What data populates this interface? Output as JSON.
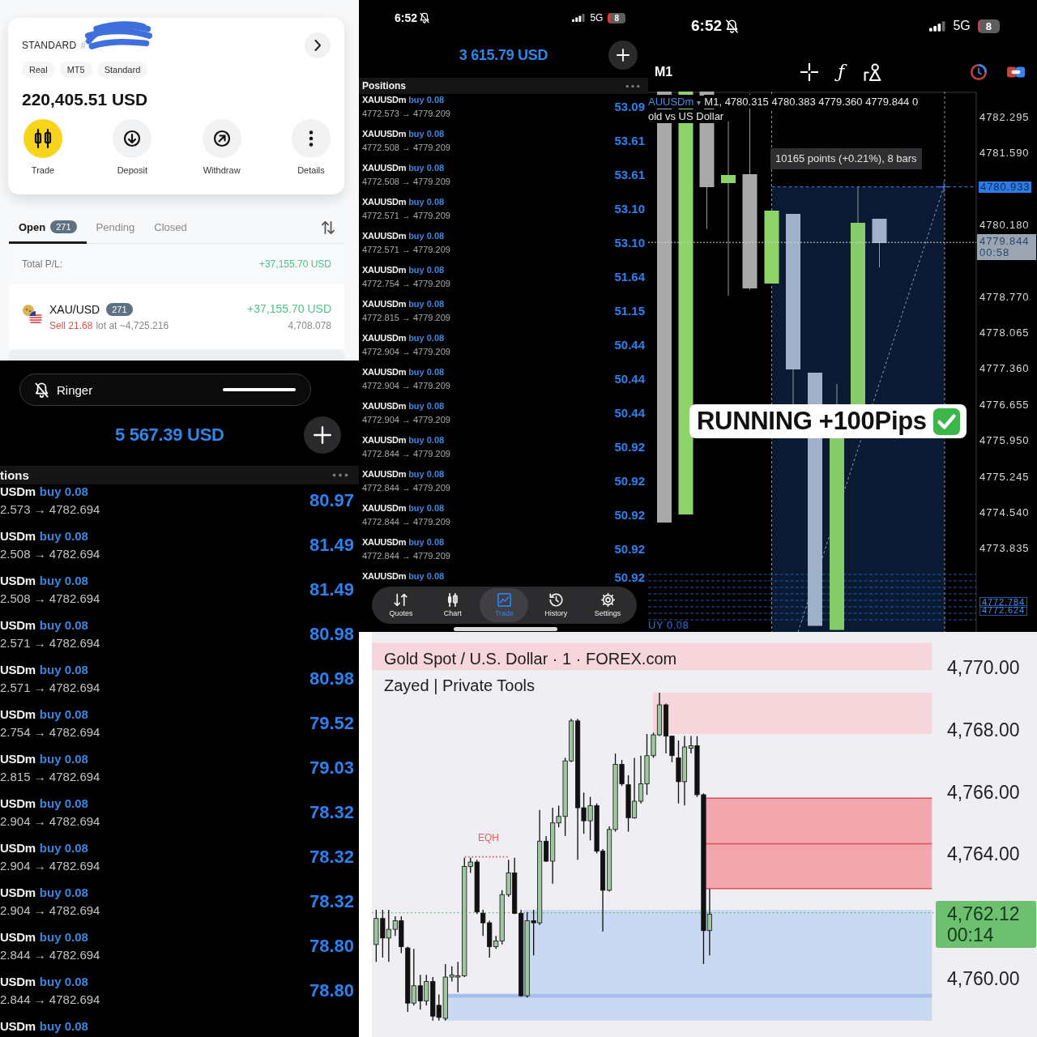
{
  "account_panel": {
    "account_label": "STANDARD",
    "account_number": "#",
    "tags": [
      "Real",
      "MT5",
      "Standard"
    ],
    "balance": "220,405.51 USD",
    "actions": [
      {
        "label": "Trade",
        "highlighted": true
      },
      {
        "label": "Deposit",
        "highlighted": false
      },
      {
        "label": "Withdraw",
        "highlighted": false
      },
      {
        "label": "Details",
        "highlighted": false
      }
    ],
    "tabs": [
      {
        "label": "Open",
        "badge": "271",
        "selected": true
      },
      {
        "label": "Pending",
        "selected": false
      },
      {
        "label": "Closed",
        "selected": false
      }
    ],
    "total_pl": {
      "label": "Total P/L:",
      "value": "+37,155.70 USD"
    },
    "position": {
      "symbol": "XAU/USD",
      "count": "271",
      "side_lot": "Sell 21.68",
      "entry": "lot at ~4,725.216",
      "pl": "+37,155.70 USD",
      "price": "4,708.078"
    }
  },
  "positions_panel": {
    "status_bar": {
      "time": "6:52",
      "network": "5G",
      "battery": "8"
    },
    "balance": "3 615.79 USD",
    "section_title": "Positions",
    "rows": [
      {
        "symbol": "XAUUSDm",
        "side": "buy 0.08",
        "prices": "4772.573 → 4779.209",
        "profit": "53.09"
      },
      {
        "symbol": "XAUUSDm",
        "side": "buy 0.08",
        "prices": "4772.508 → 4779.209",
        "profit": "53.61"
      },
      {
        "symbol": "XAUUSDm",
        "side": "buy 0.08",
        "prices": "4772.508 → 4779.209",
        "profit": "53.61"
      },
      {
        "symbol": "XAUUSDm",
        "side": "buy 0.08",
        "prices": "4772.571 → 4779.209",
        "profit": "53.10"
      },
      {
        "symbol": "XAUUSDm",
        "side": "buy 0.08",
        "prices": "4772.571 → 4779.209",
        "profit": "53.10"
      },
      {
        "symbol": "XAUUSDm",
        "side": "buy 0.08",
        "prices": "4772.754 → 4779.209",
        "profit": "51.64"
      },
      {
        "symbol": "XAUUSDm",
        "side": "buy 0.08",
        "prices": "4772.815 → 4779.209",
        "profit": "51.15"
      },
      {
        "symbol": "XAUUSDm",
        "side": "buy 0.08",
        "prices": "4772.904 → 4779.209",
        "profit": "50.44"
      },
      {
        "symbol": "XAUUSDm",
        "side": "buy 0.08",
        "prices": "4772.904 → 4779.209",
        "profit": "50.44"
      },
      {
        "symbol": "XAUUSDm",
        "side": "buy 0.08",
        "prices": "4772.904 → 4779.209",
        "profit": "50.44"
      },
      {
        "symbol": "XAUUSDm",
        "side": "buy 0.08",
        "prices": "4772.844 → 4779.209",
        "profit": "50.92"
      },
      {
        "symbol": "XAUUSDm",
        "side": "buy 0.08",
        "prices": "4772.844 → 4779.209",
        "profit": "50.92"
      },
      {
        "symbol": "XAUUSDm",
        "side": "buy 0.08",
        "prices": "4772.844 → 4779.209",
        "profit": "50.92"
      },
      {
        "symbol": "XAUUSDm",
        "side": "buy 0.08",
        "prices": "4772.844 → 4779.209",
        "profit": "50.92"
      },
      {
        "symbol": "XAUUSDm",
        "side": "buy 0.08",
        "profit": "50.92"
      }
    ],
    "nav": [
      {
        "label": "Quotes",
        "selected": false
      },
      {
        "label": "Chart",
        "selected": false
      },
      {
        "label": "Trade",
        "selected": true
      },
      {
        "label": "History",
        "selected": false
      },
      {
        "label": "Settings",
        "selected": false
      }
    ]
  },
  "chart_panel": {
    "status_bar": {
      "time": "6:52",
      "network": "5G",
      "battery": "8"
    },
    "timeframe": "M1",
    "function_button": "ƒ",
    "symbol": "AUUSDm",
    "dropdown": "▾",
    "ohlc": "M1, 4780.315 4780.383 4779.360 4779.844 0",
    "description": "old vs US Dollar",
    "measure": "10165 points (+0.21%), 8 bars",
    "price_labels": [
      {
        "value": "4782.295",
        "kind": "axis"
      },
      {
        "value": "4781.590",
        "kind": "axis"
      },
      {
        "value": "4780.933",
        "kind": "crosshair"
      },
      {
        "value": "4780.180",
        "kind": "axis"
      },
      {
        "value": "4779.844",
        "kind": "current",
        "timer": "00:58"
      },
      {
        "value": "4778.770",
        "kind": "axis"
      },
      {
        "value": "4778.065",
        "kind": "axis"
      },
      {
        "value": "4777.360",
        "kind": "axis"
      },
      {
        "value": "4776.655",
        "kind": "axis"
      },
      {
        "value": "4775.950",
        "kind": "axis"
      },
      {
        "value": "4775.245",
        "kind": "axis"
      },
      {
        "value": "4774.540",
        "kind": "axis"
      },
      {
        "value": "4773.835",
        "kind": "axis"
      },
      {
        "value": "4772.784",
        "kind": "order"
      },
      {
        "value": "4772.624",
        "kind": "order"
      }
    ],
    "order_label": "UY 0.08",
    "sticker": "RUNNING +100Pips"
  },
  "ringer_panel": {
    "banner": "Ringer",
    "balance": "5 567.39 USD",
    "section_title": "tions",
    "rows": [
      {
        "symbol": "USDm",
        "side": "buy 0.08",
        "prices": "2.573 → 4782.694",
        "profit": "80.97"
      },
      {
        "symbol": "USDm",
        "side": "buy 0.08",
        "prices": "2.508 → 4782.694",
        "profit": "81.49"
      },
      {
        "symbol": "USDm",
        "side": "buy 0.08",
        "prices": "2.508 → 4782.694",
        "profit": "81.49"
      },
      {
        "symbol": "USDm",
        "side": "buy 0.08",
        "prices": "2.571 → 4782.694",
        "profit": "80.98"
      },
      {
        "symbol": "USDm",
        "side": "buy 0.08",
        "prices": "2.571 → 4782.694",
        "profit": "80.98"
      },
      {
        "symbol": "USDm",
        "side": "buy 0.08",
        "prices": "2.754 → 4782.694",
        "profit": "79.52"
      },
      {
        "symbol": "USDm",
        "side": "buy 0.08",
        "prices": "2.815 → 4782.694",
        "profit": "79.03"
      },
      {
        "symbol": "USDm",
        "side": "buy 0.08",
        "prices": "2.904 → 4782.694",
        "profit": "78.32"
      },
      {
        "symbol": "USDm",
        "side": "buy 0.08",
        "prices": "2.904 → 4782.694",
        "profit": "78.32"
      },
      {
        "symbol": "USDm",
        "side": "buy 0.08",
        "prices": "2.904 → 4782.694",
        "profit": "78.32"
      },
      {
        "symbol": "USDm",
        "side": "buy 0.08",
        "prices": "2.844 → 4782.694",
        "profit": "78.80"
      },
      {
        "symbol": "USDm",
        "side": "buy 0.08",
        "prices": "2.844 → 4782.694",
        "profit": "78.80"
      },
      {
        "symbol": "USDm",
        "side": "buy 0.08"
      }
    ]
  },
  "tradingview_panel": {
    "title": "Gold Spot / U.S. Dollar · 1 · FOREX.com",
    "subtitle": "Zayed | Private Tools",
    "marker": "EQH",
    "price_labels": [
      "4,770.00",
      "4,768.00",
      "4,766.00",
      "4,764.00",
      "4,760.00"
    ],
    "current_price": "4,762.12",
    "countdown": "00:14"
  }
}
